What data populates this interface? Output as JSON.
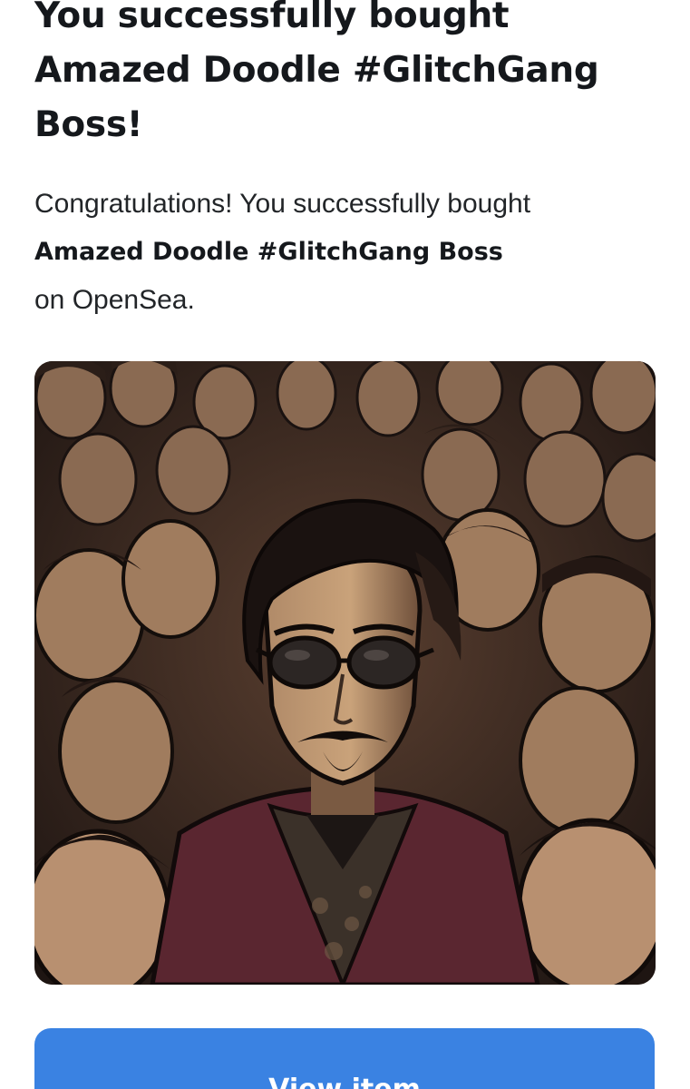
{
  "purchase": {
    "headline": "You successfully bought Amazed Doodle #GlitchGang Boss!",
    "message_prefix": "Congratulations! You successfully bought",
    "item_name": "Amazed Doodle #GlitchGang Boss",
    "message_suffix": "on OpenSea.",
    "image_icon": "nft-artwork-crowd-man-sunglasses",
    "view_button_label": "View item"
  },
  "colors": {
    "button_bg": "#3a82e2",
    "button_text": "#ffffff",
    "heading_text": "#15181c",
    "body_text": "#222528"
  }
}
